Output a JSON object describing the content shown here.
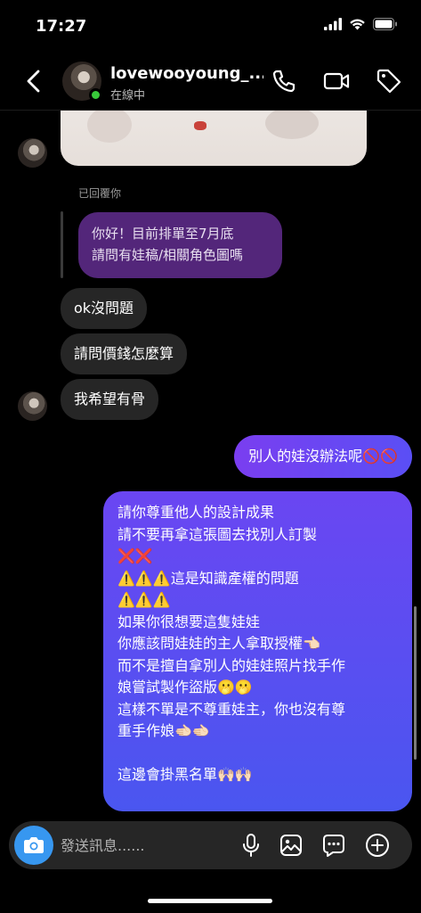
{
  "status_bar": {
    "time": "17:27"
  },
  "header": {
    "username": "lovewooyoung_...",
    "status": "在線中"
  },
  "chat": {
    "reply_label": "已回覆你",
    "quoted_message": {
      "line1": "你好！目前排單至7月底",
      "line2": "請問有娃稿/相關角色圖嗎"
    },
    "incoming": [
      {
        "text": "ok沒問題"
      },
      {
        "text": "請問價錢怎麼算"
      },
      {
        "text": "我希望有骨"
      }
    ],
    "outgoing_short": "別人的娃沒辦法呢🚫🚫",
    "outgoing_long": {
      "lines": [
        "請你尊重他人的設計成果",
        "請不要再拿這張圖去找別人訂製",
        "❌❌",
        "⚠️⚠️⚠️這是知識產權的問題",
        "⚠️⚠️⚠️",
        "如果你很想要這隻娃娃",
        "你應該問娃娃的主人拿取授權👈🏻",
        "而不是擅自拿別人的娃娃照片找手作",
        "娘嘗試製作盜版🫢🫢",
        "這樣不單是不尊重娃主，你也沒有尊",
        "重手作娘🫲🏻🫲🏻",
        "",
        "這邊會掛黑名單🙌🏻🙌🏻"
      ]
    }
  },
  "composer": {
    "placeholder": "發送訊息......"
  },
  "colors": {
    "background": "#000000",
    "incoming_bubble": "#262626",
    "reply_bubble": "#53267a",
    "outgoing_gradient_start": "#7a3ef0",
    "outgoing_gradient_end": "#4a56f0",
    "camera_button": "#3797f0",
    "online_dot": "#38c93a"
  },
  "icons": [
    "back-chevron-icon",
    "phone-icon",
    "video-camera-icon",
    "tag-icon",
    "camera-icon",
    "microphone-icon",
    "gallery-icon",
    "sticker-icon",
    "plus-icon",
    "signal-icon",
    "wifi-icon",
    "battery-icon"
  ]
}
